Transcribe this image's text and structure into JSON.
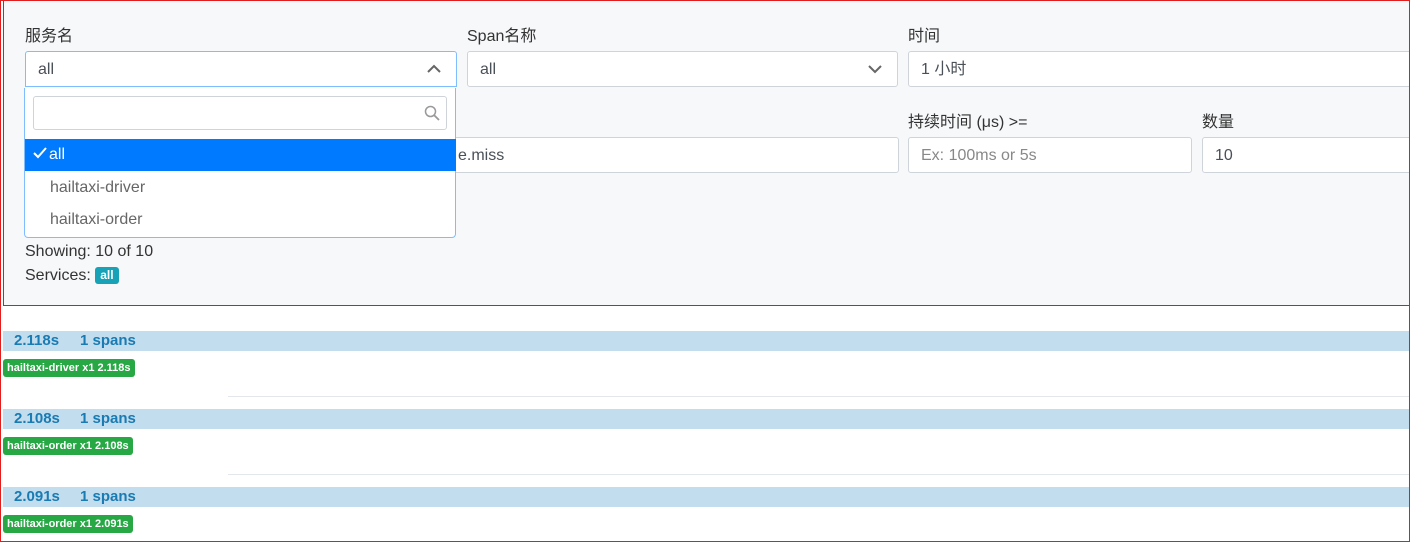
{
  "filters": {
    "service_label": "服务名",
    "service_value": "all",
    "span_label": "Span名称",
    "span_value": "all",
    "time_label": "时间",
    "time_value": "1 小时",
    "tag_value_partial": "e.miss",
    "duration_label": "持续时间 (μs) >=",
    "duration_placeholder": "Ex: 100ms or 5s",
    "count_label": "数量",
    "count_value": "10"
  },
  "dropdown": {
    "search_value": "",
    "items": [
      {
        "label": "all",
        "selected": true
      },
      {
        "label": "hailtaxi-driver",
        "selected": false
      },
      {
        "label": "hailtaxi-order",
        "selected": false
      }
    ]
  },
  "summary": {
    "showing": "Showing: 10 of 10",
    "services_label": "Services:",
    "services_badge": "all"
  },
  "traces": [
    {
      "duration": "2.118s",
      "spans": "1 spans",
      "service_badge": "hailtaxi-driver x1 2.118s"
    },
    {
      "duration": "2.108s",
      "spans": "1 spans",
      "service_badge": "hailtaxi-order x1 2.108s"
    },
    {
      "duration": "2.091s",
      "spans": "1 spans",
      "service_badge": "hailtaxi-order x1 2.091s"
    }
  ],
  "colors": {
    "selected_item": "#007bff",
    "trace_bar": "#c2ddee",
    "service_badge": "#28a745",
    "services_badge": "#17a2b8"
  }
}
